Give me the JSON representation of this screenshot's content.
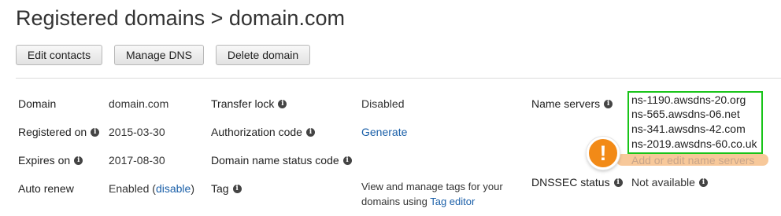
{
  "header": {
    "breadcrumb": "Registered domains > domain.com"
  },
  "toolbar": {
    "edit_contacts": "Edit contacts",
    "manage_dns": "Manage DNS",
    "delete_domain": "Delete domain"
  },
  "details": {
    "domain": {
      "label": "Domain",
      "value": "domain.com"
    },
    "registered_on": {
      "label": "Registered on",
      "value": "2015-03-30"
    },
    "expires_on": {
      "label": "Expires on",
      "value": "2017-08-30"
    },
    "auto_renew": {
      "label": "Auto renew",
      "value_prefix": "Enabled (",
      "link": "disable",
      "value_suffix": ")"
    },
    "transfer_lock": {
      "label": "Transfer lock",
      "value": "Disabled"
    },
    "authorization_code": {
      "label": "Authorization code",
      "link": "Generate"
    },
    "domain_status_code": {
      "label": "Domain name status code",
      "value": ""
    },
    "tag": {
      "label": "Tag",
      "text_line1": "View and manage tags for your",
      "text_line2": "domains using",
      "link": "Tag editor"
    },
    "name_servers": {
      "label": "Name servers",
      "items": [
        "ns-1190.awsdns-20.org",
        "ns-565.awsdns-06.net",
        "ns-341.awsdns-42.com",
        "ns-2019.awsdns-60.co.uk"
      ],
      "edit_link": "Add or edit name servers"
    },
    "dnssec_status": {
      "label": "DNSSEC status",
      "value": "Not available"
    }
  },
  "annotation": {
    "symbol": "!",
    "highlight_color": "#19c419",
    "warning_color": "#f28a17"
  },
  "icons": {
    "info": "i"
  }
}
